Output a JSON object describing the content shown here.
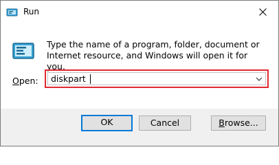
{
  "window": {
    "title": "Run"
  },
  "content": {
    "description": "Type the name of a program, folder, document or Internet resource, and Windows will open it for you.",
    "open_label_underlined": "O",
    "open_label_rest": "pen:",
    "input_value": "diskpart"
  },
  "buttons": {
    "ok": "OK",
    "cancel": "Cancel",
    "browse_underlined": "B",
    "browse_rest": "rowse..."
  },
  "colors": {
    "highlight_border": "#e0282e",
    "focus_border": "#0078d7",
    "footer_bg": "#f0f0f0"
  },
  "icons": {
    "title_icon": "run-icon",
    "dialog_icon": "run-icon",
    "close": "close-icon",
    "dropdown": "chevron-down-icon"
  }
}
